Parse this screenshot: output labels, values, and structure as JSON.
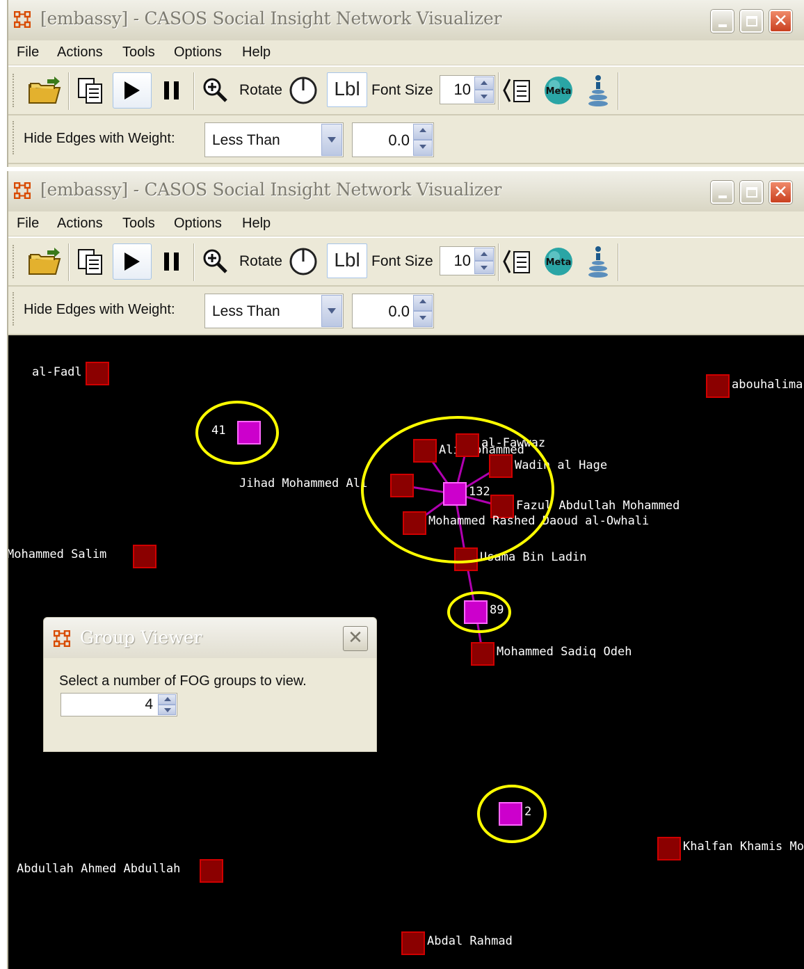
{
  "window": {
    "title": "[embassy] - CASOS Social Insight Network Visualizer",
    "icon": "network-grid-icon",
    "controls": [
      "minimize-icon",
      "maximize-icon",
      "close-icon"
    ]
  },
  "menu": [
    "File",
    "Actions",
    "Tools",
    "Options",
    "Help"
  ],
  "toolbar": {
    "open_icon": "open-folder-icon",
    "copy_icon": "copy-icon",
    "play_icon": "play-icon",
    "pause_icon": "pause-icon",
    "zoom_icon": "zoom-in-icon",
    "rotate_label": "Rotate",
    "rotate_icon": "rotate-dial-icon",
    "lbl_label": "Lbl",
    "font_size_label": "Font Size",
    "font_size_value": "10",
    "legend_icon": "legend-icon",
    "meta_label": "Meta",
    "layout_icon": "node-stack-icon"
  },
  "filter": {
    "label": "Hide Edges with Weight:",
    "comparison": "Less Than",
    "value": "0.0"
  },
  "network": {
    "colors": {
      "background": "#000000",
      "agent_node": "#8b0000",
      "group_node": "#cc00cc",
      "edge": "#b000b0",
      "highlight": "#ffff00",
      "label": "#ffffff"
    },
    "agents": [
      {
        "id": "al-fadl",
        "label": "al-Fadl"
      },
      {
        "id": "abouhalima",
        "label": "abouhalima"
      },
      {
        "id": "ali-mohammed",
        "label": "Ali Mohammed"
      },
      {
        "id": "al-fawwaz",
        "label": "al-Fawwaz"
      },
      {
        "id": "wadih",
        "label": "Wadih al Hage"
      },
      {
        "id": "jihad",
        "label": "Jihad Mohammed Ali"
      },
      {
        "id": "fazul",
        "label": "Fazul Abdullah Mohammed"
      },
      {
        "id": "owhali",
        "label": "Mohammed Rashed Daoud al-Owhali"
      },
      {
        "id": "salim",
        "label": "Mohammed Salim"
      },
      {
        "id": "bin-ladin",
        "label": "Usama Bin Ladin"
      },
      {
        "id": "odeh",
        "label": "Mohammed Sadiq Odeh"
      },
      {
        "id": "khalfan",
        "label": "Khalfan Khamis Mohamed"
      },
      {
        "id": "abdullah",
        "label": "Abdullah Ahmed Abdullah"
      },
      {
        "id": "abdal",
        "label": "Abdal Rahmad"
      }
    ],
    "groups": [
      {
        "id": "g41",
        "label": "41",
        "highlighted": true
      },
      {
        "id": "g132",
        "label": "132",
        "highlighted": true
      },
      {
        "id": "g89",
        "label": "89",
        "highlighted": true
      },
      {
        "id": "g2",
        "label": "2",
        "highlighted": true
      }
    ],
    "edges": [
      [
        "g132",
        "ali-mohammed"
      ],
      [
        "g132",
        "al-fawwaz"
      ],
      [
        "g132",
        "wadih"
      ],
      [
        "g132",
        "jihad"
      ],
      [
        "g132",
        "fazul"
      ],
      [
        "g132",
        "owhali"
      ],
      [
        "g132",
        "bin-ladin"
      ],
      [
        "bin-ladin",
        "g89"
      ],
      [
        "g89",
        "odeh"
      ]
    ]
  },
  "group_viewer": {
    "title": "Group Viewer",
    "icon": "network-grid-icon",
    "prompt": "Select a number of FOG groups to view.",
    "value": "4"
  }
}
